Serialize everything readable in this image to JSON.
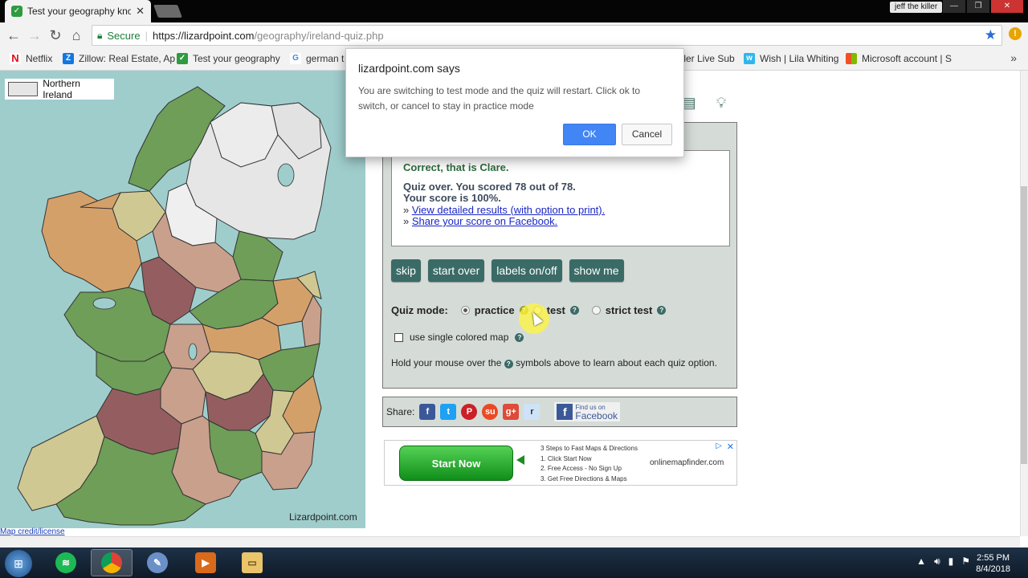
{
  "browser": {
    "tab_title": "Test your geography kno",
    "profile_name": "jeff the killer",
    "secure_label": "Secure",
    "url_host": "https://lizardpoint.com",
    "url_path": "/geography/ireland-quiz.php"
  },
  "bookmarks": [
    {
      "label": "Netflix",
      "icon": "netflix-icon",
      "color": "#e50914"
    },
    {
      "label": "Zillow: Real Estate, Ap",
      "icon": "zillow-icon",
      "color": "#1277e1"
    },
    {
      "label": "Test your geography",
      "icon": "lizardpoint-icon",
      "color": "#2e9b41"
    },
    {
      "label": "german t",
      "icon": "google-icon",
      "color": "#4285f4"
    },
    {
      "label": "iller Live Sub",
      "icon": "generic-icon",
      "color": "#888888"
    },
    {
      "label": "Wish | Lila Whiting",
      "icon": "wish-icon",
      "color": "#2fb7ec"
    },
    {
      "label": "Microsoft account | S",
      "icon": "microsoft-icon",
      "color": "#f25022"
    }
  ],
  "map": {
    "legend_label": "Northern Ireland",
    "brand": "Lizardpoint.com",
    "credit_link": "Map credit/license"
  },
  "quiz": {
    "correct_msg": "Correct, that is Clare.",
    "score_line1": "Quiz over. You scored 78 out of 78.",
    "score_line2": "Your score is 100%.",
    "link_results": "View detailed results (with option to print).",
    "link_share": "Share your score on Facebook.",
    "bullet": "»",
    "buttons": {
      "skip": "skip",
      "start_over": "start over",
      "labels": "labels on/off",
      "show_me": "show me"
    },
    "mode_label": "Quiz mode:",
    "mode_practice": "practice",
    "mode_test": "test",
    "mode_strict": "strict test",
    "single_color": "use single colored map",
    "hold_before": "Hold your mouse over the",
    "hold_after": "symbols above to learn about each quiz option."
  },
  "share": {
    "label": "Share:",
    "fb_small": "Find us on",
    "fb_big": "Facebook"
  },
  "ad": {
    "button": "Start Now",
    "lines": [
      "3 Steps to Fast Maps & Directions",
      "1. Click Start Now",
      "2. Free Access - No Sign Up",
      "3. Get Free Directions & Maps"
    ],
    "site": "onlinemapfinder.com"
  },
  "dialog": {
    "title": "lizardpoint.com says",
    "message": "You are switching to test mode and the quiz will restart. Click ok to switch, or cancel to stay in practice mode",
    "ok": "OK",
    "cancel": "Cancel"
  },
  "taskbar": {
    "time": "2:55 PM",
    "date": "8/4/2018"
  },
  "colors": {
    "accent_button": "#3b6b66",
    "dialog_ok": "#4285f4",
    "map_sea": "#9fcdcc"
  }
}
